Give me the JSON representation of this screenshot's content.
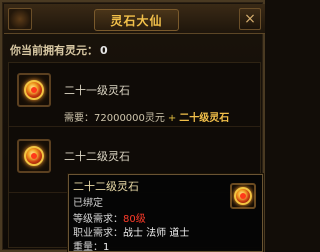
{
  "window": {
    "title": "灵石大仙",
    "close_label": "×"
  },
  "owned": {
    "label": "你当前拥有灵元：",
    "value": "0"
  },
  "items": [
    {
      "name": "二十一级灵石",
      "req_label": "需要：",
      "req_amount": "72000000灵元",
      "req_plus": "+",
      "req_item": "二十级灵石"
    },
    {
      "name": "二十二级灵石"
    }
  ],
  "tooltip": {
    "name": "二十二级灵石",
    "bound": "已绑定",
    "level_label": "等级需求：",
    "level_value": "80级",
    "class_label": "职业需求：",
    "class_value": "战士 法师 道士",
    "weight_label": "重量：",
    "weight_value": "1"
  },
  "colors": {
    "title": "#f2c04a",
    "red_requirement": "#ff3b2a",
    "gold_accent": "#f2c04a"
  },
  "icons": {
    "item_icon": "spirit-stone-gem-icon",
    "close": "close-icon",
    "ornament": "ornament-icon"
  }
}
